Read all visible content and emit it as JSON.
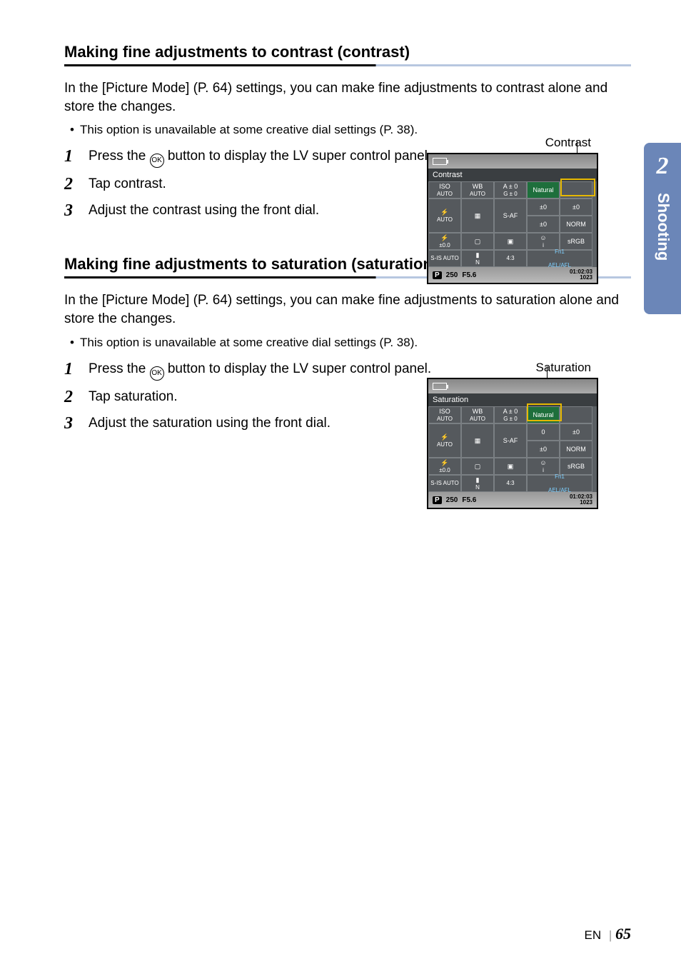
{
  "tab": {
    "number": "2",
    "label": "Shooting"
  },
  "section1": {
    "title": "Making fine adjustments to contrast (contrast)",
    "intro": "In the [Picture Mode] (P. 64) settings, you can make fine adjustments to contrast alone and store the changes.",
    "bullet": "This option is unavailable at some creative dial settings (P. 38).",
    "step1a": "Press the ",
    "step1b": " button to display the LV super control panel.",
    "step2": "Tap contrast.",
    "step3": "Adjust the contrast using the front dial.",
    "figLabel": "Contrast",
    "okLabel": "OK"
  },
  "section2": {
    "title": "Making fine adjustments to saturation (saturation)",
    "intro": "In the [Picture Mode] (P. 64) settings, you can make fine adjustments to saturation alone and store the changes.",
    "bullet": "This option is unavailable at some creative dial settings (P. 38).",
    "step1a": "Press the ",
    "step1b": " button to display the LV super control panel.",
    "step2": "Tap saturation.",
    "step3": "Adjust the saturation using the front dial.",
    "figLabel": "Saturation",
    "okLabel": "OK"
  },
  "panel1": {
    "banner": "Contrast",
    "cells": {
      "iso": "ISO",
      "isoSub": "AUTO",
      "wb": "WB",
      "wbSub": "AUTO",
      "a0": "A ± 0",
      "g0": "G ± 0",
      "natural": "Natural",
      "s0": "±0",
      "o0": "±0",
      "flash": "AUTO",
      "saf": "S-AF",
      "hl0": "±0",
      "norm": "NORM",
      "face": "i",
      "srgb": "sRGB",
      "ev": "±0.0",
      "fn1": "Fn1",
      "sis": "S-IS AUTO",
      "ln": "N",
      "ratio": "4:3",
      "ael": "AEL/AFL"
    },
    "bottom": {
      "mode": "P",
      "shutter": "250",
      "ap": "F5.6",
      "time": "01:02:03",
      "count": "1023"
    }
  },
  "panel2": {
    "banner": "Saturation",
    "cells": {
      "iso": "ISO",
      "isoSub": "AUTO",
      "wb": "WB",
      "wbSub": "AUTO",
      "a0": "A ± 0",
      "g0": "G ± 0",
      "natural": "Natural",
      "s0": "0",
      "o0": "±0",
      "flash": "AUTO",
      "saf": "S-AF",
      "hl0": "±0",
      "norm": "NORM",
      "face": "i",
      "srgb": "sRGB",
      "ev": "±0.0",
      "fn1": "Fn1",
      "sis": "S-IS AUTO",
      "ln": "N",
      "ratio": "4:3",
      "ael": "AEL/AFL"
    },
    "bottom": {
      "mode": "P",
      "shutter": "250",
      "ap": "F5.6",
      "time": "01:02:03",
      "count": "1023"
    }
  },
  "footer": {
    "lang": "EN",
    "page": "65"
  }
}
